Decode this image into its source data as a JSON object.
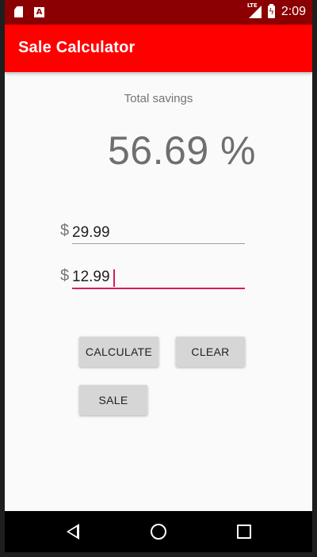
{
  "status_bar": {
    "time": "2:09",
    "network_label": "LTE",
    "icons_left": [
      "sd-card-icon",
      "font-a-icon"
    ],
    "icons_right": [
      "signal-icon",
      "battery-charging-icon"
    ]
  },
  "app_bar": {
    "title": "Sale Calculator",
    "color": "#ff0000"
  },
  "savings": {
    "label": "Total savings",
    "value": "56.69 %"
  },
  "fields": {
    "original_price": {
      "currency": "$",
      "value": "29.99"
    },
    "sale_price": {
      "currency": "$",
      "value": "12.99"
    }
  },
  "buttons": {
    "calculate": "CALCULATE",
    "clear": "CLEAR",
    "sale": "SALE"
  },
  "nav_bar": {
    "icons": [
      "back-icon",
      "home-icon",
      "recents-icon"
    ]
  },
  "colors": {
    "status_bar": "#8b0000",
    "accent": "#d81b60",
    "button": "#d6d6d6"
  }
}
